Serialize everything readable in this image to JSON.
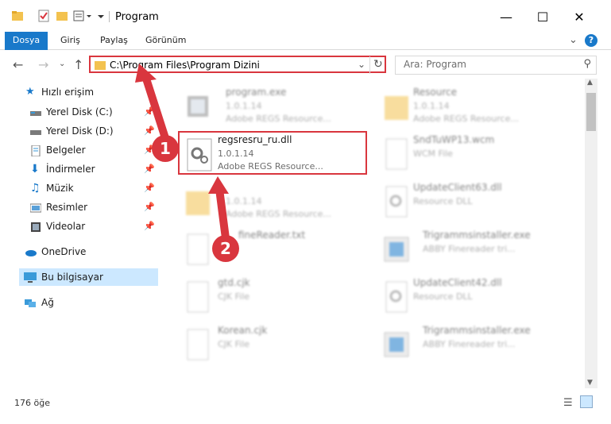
{
  "window": {
    "title": "Program",
    "minimize_icon": "minimize-icon",
    "maximize_icon": "maximize-icon",
    "close_icon": "close-icon"
  },
  "ribbon": {
    "tabs": [
      "Dosya",
      "Giriş",
      "Paylaş",
      "Görünüm"
    ]
  },
  "address": {
    "path": "C:\\Program Files\\Program Dizini",
    "search_placeholder": "Ara: Program"
  },
  "sidebar": {
    "items": [
      {
        "label": "Hızlı erişim",
        "icon": "star-icon"
      },
      {
        "label": "Yerel Disk (C:)",
        "icon": "drive-icon"
      },
      {
        "label": "Yerel Disk (D:)",
        "icon": "drive-icon"
      },
      {
        "label": "Belgeler",
        "icon": "documents-icon"
      },
      {
        "label": "İndirmeler",
        "icon": "download-icon"
      },
      {
        "label": "Müzik",
        "icon": "music-icon"
      },
      {
        "label": "Resimler",
        "icon": "pictures-icon"
      },
      {
        "label": "Videolar",
        "icon": "video-icon"
      },
      {
        "label": "OneDrive",
        "icon": "cloud-icon"
      },
      {
        "label": "Bu bilgisayar",
        "icon": "computer-icon"
      },
      {
        "label": "Ağ",
        "icon": "network-icon"
      }
    ]
  },
  "files": [
    {
      "name": "program.exe",
      "line2": "1.0.1.14",
      "line3": "Adobe REGS Resource..."
    },
    {
      "name": "Resource",
      "line2": "1.0.1.14",
      "line3": "Adobe REGS Resource..."
    },
    {
      "name": "regsresru_ru.dll",
      "line2": "1.0.1.14",
      "line3": "Adobe REGS Resource..."
    },
    {
      "name": "SndTuWP13.wcm",
      "line2": "WCM File",
      "line3": ""
    },
    {
      "name": "",
      "line2": "1.0.1.14",
      "line3": "Adobe REGS Resource..."
    },
    {
      "name": "UpdateClient63.dll",
      "line2": "Resource DLL",
      "line3": ""
    },
    {
      "name": "fineReader.txt",
      "line2": "",
      "line3": ""
    },
    {
      "name": "Trigrammsinstaller.exe",
      "line2": "ABBY Finereader tri...",
      "line3": ""
    },
    {
      "name": "gtd.cjk",
      "line2": "CJK File",
      "line3": ""
    },
    {
      "name": "UpdateClient42.dll",
      "line2": "Resource DLL",
      "line3": ""
    },
    {
      "name": "Korean.cjk",
      "line2": "CJK File",
      "line3": ""
    },
    {
      "name": "Trigrammsinstaller.exe",
      "line2": "ABBY Finereader tri...",
      "line3": ""
    }
  ],
  "status": {
    "count": "176 öğe"
  },
  "callouts": [
    "1",
    "2"
  ],
  "colors": {
    "accent": "#1979ca",
    "highlight": "#d9363e",
    "selected": "#cce8ff"
  }
}
